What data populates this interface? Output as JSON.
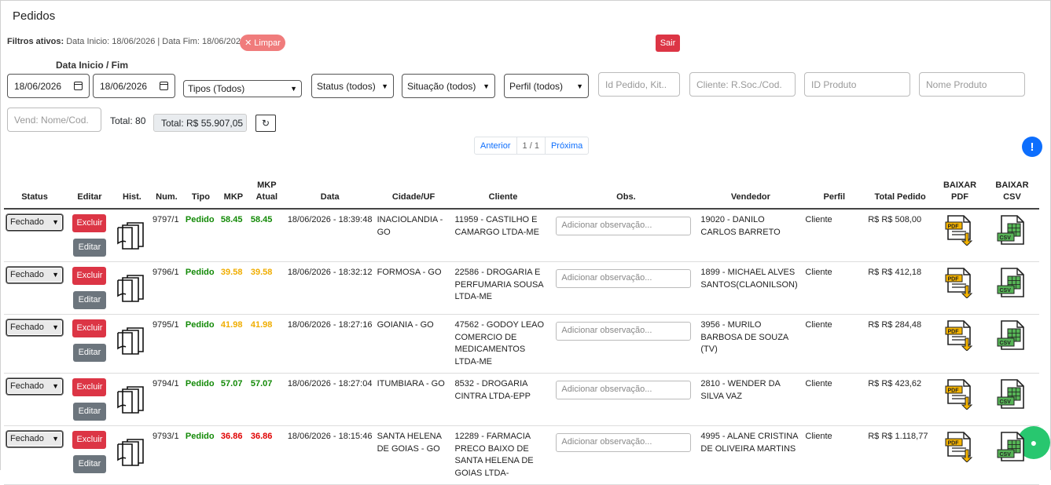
{
  "page": {
    "title": "Pedidos"
  },
  "filters": {
    "label": "Filtros ativos:",
    "text": "Data Inicio: 18/06/2026 | Data Fim: 18/06/2026",
    "clear_label": "Limpar",
    "logout_label": "Sair"
  },
  "form": {
    "date_label": "Data Inicio / Fim",
    "date_start": "18/06/2026",
    "date_end": "18/06/2026",
    "tipos": "Tipos (Todos)",
    "status": "Status (todos)",
    "situacao": "Situação (todos)",
    "perfil": "Perfil (todos)",
    "id_pedido_ph": "Id Pedido, Kit..",
    "cliente_ph": "Cliente: R.Soc./Cod.",
    "id_produto_ph": "ID Produto",
    "nome_produto_ph": "Nome Produto",
    "vendedor_ph": "Vend: Nome/Cod."
  },
  "summary": {
    "total_label": "Total: 80",
    "total_value": "Total: R$ 55.907,05"
  },
  "pager": {
    "prev": "Anterior",
    "current": "1 / 1",
    "next": "Próxima"
  },
  "table": {
    "headers": {
      "status": "Status",
      "editar": "Editar",
      "hist": "Hist.",
      "num": "Num.",
      "tipo": "Tipo",
      "mkp": "MKP",
      "mkp_atual_1": "MKP",
      "mkp_atual_2": "Atual",
      "data": "Data",
      "cidade": "Cidade/UF",
      "cliente": "Cliente",
      "obs": "Obs.",
      "vendedor": "Vendedor",
      "perfil": "Perfil",
      "total": "Total Pedido",
      "pdf_1": "BAIXAR",
      "pdf_2": "PDF",
      "csv_1": "BAIXAR",
      "csv_2": "CSV"
    },
    "status_option": "Fechado",
    "excluir_label": "Excluir",
    "editar_label": "Editar",
    "obs_placeholder": "Adicionar observação...",
    "rows": [
      {
        "num": "9797/1",
        "tipo": "Pedido",
        "mkp": "58.45",
        "mkp_atual": "58.45",
        "mkp_color": "#138a07",
        "data": "18/06/2026 - 18:39:48",
        "cidade": "INACIOLANDIA - GO",
        "cliente": "11959 - CASTILHO E CAMARGO LTDA-ME",
        "vendedor": "19020 - DANILO CARLOS BARRETO",
        "perfil": "Cliente",
        "total": "R$ R$ 508,00"
      },
      {
        "num": "9796/1",
        "tipo": "Pedido",
        "mkp": "39.58",
        "mkp_atual": "39.58",
        "mkp_color": "#f0ad00",
        "data": "18/06/2026 - 18:32:12",
        "cidade": "FORMOSA - GO",
        "cliente": "22586 - DROGARIA E PERFUMARIA SOUSA LTDA-ME",
        "vendedor": "1899 - MICHAEL ALVES SANTOS(CLAONILSON)",
        "perfil": "Cliente",
        "total": "R$ R$ 412,18"
      },
      {
        "num": "9795/1",
        "tipo": "Pedido",
        "mkp": "41.98",
        "mkp_atual": "41.98",
        "mkp_color": "#f0ad00",
        "data": "18/06/2026 - 18:27:16",
        "cidade": "GOIANIA - GO",
        "cliente": "47562 - GODOY LEAO COMERCIO DE MEDICAMENTOS LTDA-ME",
        "vendedor": "3956 - MURILO BARBOSA DE SOUZA (TV)",
        "perfil": "Cliente",
        "total": "R$ R$ 284,48"
      },
      {
        "num": "9794/1",
        "tipo": "Pedido",
        "mkp": "57.07",
        "mkp_atual": "57.07",
        "mkp_color": "#138a07",
        "data": "18/06/2026 - 18:27:04",
        "cidade": "ITUMBIARA - GO",
        "cliente": "8532 - DROGARIA CINTRA LTDA-EPP",
        "vendedor": "2810 - WENDER DA SILVA VAZ",
        "perfil": "Cliente",
        "total": "R$ R$ 423,62"
      },
      {
        "num": "9793/1",
        "tipo": "Pedido",
        "mkp": "36.86",
        "mkp_atual": "36.86",
        "mkp_color": "#e00000",
        "data": "18/06/2026 - 18:15:46",
        "cidade": "SANTA HELENA DE GOIAS - GO",
        "cliente": "12289 - FARMACIA PRECO BAIXO DE SANTA HELENA DE GOIAS LTDA-",
        "vendedor": "4995 - ALANE CRISTINA DE OLIVEIRA MARTINS",
        "perfil": "Cliente",
        "total": "R$ R$ 1.118,77"
      }
    ]
  },
  "widgets": {
    "alert_icon": "!",
    "chat_icon": "chat-icon"
  }
}
